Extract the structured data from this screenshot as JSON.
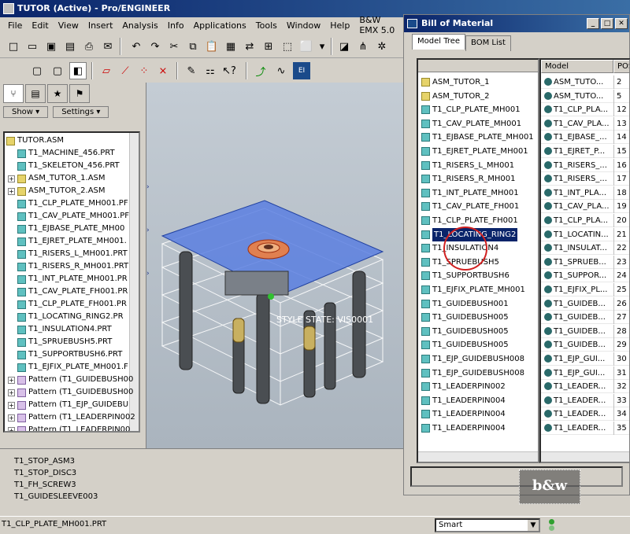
{
  "app": {
    "title": "TUTOR (Active) - Pro/ENGINEER"
  },
  "menu": [
    "File",
    "Edit",
    "View",
    "Insert",
    "Analysis",
    "Info",
    "Applications",
    "Tools",
    "Window",
    "Help",
    "B&W EMX 5.0"
  ],
  "left_panel": {
    "show_label": "Show",
    "settings_label": "Settings",
    "tree": [
      {
        "label": "TUTOR.ASM",
        "type": "asm",
        "expander": false,
        "indent": 0
      },
      {
        "label": "T1_MACHINE_456.PRT",
        "type": "prt",
        "expander": false,
        "indent": 1
      },
      {
        "label": "T1_SKELETON_456.PRT",
        "type": "prt",
        "expander": false,
        "indent": 1
      },
      {
        "label": "ASM_TUTOR_1.ASM",
        "type": "asm",
        "expander": true,
        "indent": 1
      },
      {
        "label": "ASM_TUTOR_2.ASM",
        "type": "asm",
        "expander": true,
        "indent": 1
      },
      {
        "label": "T1_CLP_PLATE_MH001.PF",
        "type": "prt",
        "expander": false,
        "indent": 1
      },
      {
        "label": "T1_CAV_PLATE_MH001.PF",
        "type": "prt",
        "expander": false,
        "indent": 1
      },
      {
        "label": "T1_EJBASE_PLATE_MH00",
        "type": "prt",
        "expander": false,
        "indent": 1
      },
      {
        "label": "T1_EJRET_PLATE_MH001.",
        "type": "prt",
        "expander": false,
        "indent": 1
      },
      {
        "label": "T1_RISERS_L_MH001.PRT",
        "type": "prt",
        "expander": false,
        "indent": 1
      },
      {
        "label": "T1_RISERS_R_MH001.PRT",
        "type": "prt",
        "expander": false,
        "indent": 1
      },
      {
        "label": "T1_INT_PLATE_MH001.PR",
        "type": "prt",
        "expander": false,
        "indent": 1
      },
      {
        "label": "T1_CAV_PLATE_FH001.PR",
        "type": "prt",
        "expander": false,
        "indent": 1
      },
      {
        "label": "T1_CLP_PLATE_FH001.PR",
        "type": "prt",
        "expander": false,
        "indent": 1
      },
      {
        "label": "T1_LOCATING_RING2.PR",
        "type": "prt",
        "expander": false,
        "indent": 1
      },
      {
        "label": "T1_INSULATION4.PRT",
        "type": "prt",
        "expander": false,
        "indent": 1
      },
      {
        "label": "T1_SPRUEBUSH5.PRT",
        "type": "prt",
        "expander": false,
        "indent": 1
      },
      {
        "label": "T1_SUPPORTBUSH6.PRT",
        "type": "prt",
        "expander": false,
        "indent": 1
      },
      {
        "label": "T1_EJFIX_PLATE_MH001.F",
        "type": "prt",
        "expander": false,
        "indent": 1
      },
      {
        "label": "Pattern (T1_GUIDEBUSH00",
        "type": "pat",
        "expander": true,
        "indent": 1
      },
      {
        "label": "Pattern (T1_GUIDEBUSH00",
        "type": "pat",
        "expander": true,
        "indent": 1
      },
      {
        "label": "Pattern (T1_EJP_GUIDEBU",
        "type": "pat",
        "expander": true,
        "indent": 1
      },
      {
        "label": "Pattern (T1_LEADERPIN002",
        "type": "pat",
        "expander": true,
        "indent": 1
      },
      {
        "label": "Pattern (T1_LEADERPIN00",
        "type": "pat",
        "expander": true,
        "indent": 1
      }
    ]
  },
  "viewport": {
    "overlay_text": "STYLE STATE: VIS0001"
  },
  "messages": [
    "T1_STOP_ASM3",
    "T1_STOP_DISC3",
    "T1_FH_SCREW3",
    "T1_GUIDESLEEVE003"
  ],
  "status": {
    "current": "T1_CLP_PLATE_MH001.PRT",
    "filter": "Smart"
  },
  "bom": {
    "title": "Bill of Material",
    "tabs": [
      "Model Tree",
      "BOM List"
    ],
    "col_model": "Model",
    "col_pos": "POS",
    "tree": [
      {
        "label": "ASM_TUTOR_1",
        "type": "asm"
      },
      {
        "label": "ASM_TUTOR_2",
        "type": "asm"
      },
      {
        "label": "T1_CLP_PLATE_MH001",
        "type": "prt"
      },
      {
        "label": "T1_CAV_PLATE_MH001",
        "type": "prt"
      },
      {
        "label": "T1_EJBASE_PLATE_MH001",
        "type": "prt"
      },
      {
        "label": "T1_EJRET_PLATE_MH001",
        "type": "prt"
      },
      {
        "label": "T1_RISERS_L_MH001",
        "type": "prt"
      },
      {
        "label": "T1_RISERS_R_MH001",
        "type": "prt"
      },
      {
        "label": "T1_INT_PLATE_MH001",
        "type": "prt"
      },
      {
        "label": "T1_CAV_PLATE_FH001",
        "type": "prt"
      },
      {
        "label": "T1_CLP_PLATE_FH001",
        "type": "prt"
      },
      {
        "label": "T1_LOCATING_RING2",
        "type": "prt",
        "selected": true
      },
      {
        "label": "T1_INSULATION4",
        "type": "prt"
      },
      {
        "label": "T1_SPRUEBUSH5",
        "type": "prt"
      },
      {
        "label": "T1_SUPPORTBUSH6",
        "type": "prt"
      },
      {
        "label": "T1_EJFIX_PLATE_MH001",
        "type": "prt"
      },
      {
        "label": "T1_GUIDEBUSH001",
        "type": "prt"
      },
      {
        "label": "T1_GUIDEBUSH005",
        "type": "prt"
      },
      {
        "label": "T1_GUIDEBUSH005",
        "type": "prt"
      },
      {
        "label": "T1_GUIDEBUSH005",
        "type": "prt"
      },
      {
        "label": "T1_EJP_GUIDEBUSH008",
        "type": "prt"
      },
      {
        "label": "T1_EJP_GUIDEBUSH008",
        "type": "prt"
      },
      {
        "label": "T1_LEADERPIN002",
        "type": "prt"
      },
      {
        "label": "T1_LEADERPIN004",
        "type": "prt"
      },
      {
        "label": "T1_LEADERPIN004",
        "type": "prt"
      },
      {
        "label": "T1_LEADERPIN004",
        "type": "prt"
      }
    ],
    "rows": [
      {
        "model": "ASM_TUTO...",
        "pos": "2"
      },
      {
        "model": "ASM_TUTO...",
        "pos": "5"
      },
      {
        "model": "T1_CLP_PLA...",
        "pos": "12"
      },
      {
        "model": "T1_CAV_PLA...",
        "pos": "13"
      },
      {
        "model": "T1_EJBASE_...",
        "pos": "14"
      },
      {
        "model": "T1_EJRET_P...",
        "pos": "15"
      },
      {
        "model": "T1_RISERS_...",
        "pos": "16"
      },
      {
        "model": "T1_RISERS_...",
        "pos": "17"
      },
      {
        "model": "T1_INT_PLA...",
        "pos": "18"
      },
      {
        "model": "T1_CAV_PLA...",
        "pos": "19"
      },
      {
        "model": "T1_CLP_PLA...",
        "pos": "20"
      },
      {
        "model": "T1_LOCATIN...",
        "pos": "21"
      },
      {
        "model": "T1_INSULAT...",
        "pos": "22"
      },
      {
        "model": "T1_SPRUEB...",
        "pos": "23"
      },
      {
        "model": "T1_SUPPOR...",
        "pos": "24"
      },
      {
        "model": "T1_EJFIX_PL...",
        "pos": "25"
      },
      {
        "model": "T1_GUIDEB...",
        "pos": "26"
      },
      {
        "model": "T1_GUIDEB...",
        "pos": "27"
      },
      {
        "model": "T1_GUIDEB...",
        "pos": "28"
      },
      {
        "model": "T1_GUIDEB...",
        "pos": "29"
      },
      {
        "model": "T1_EJP_GUI...",
        "pos": "30"
      },
      {
        "model": "T1_EJP_GUI...",
        "pos": "31"
      },
      {
        "model": "T1_LEADER...",
        "pos": "32"
      },
      {
        "model": "T1_LEADER...",
        "pos": "33"
      },
      {
        "model": "T1_LEADER...",
        "pos": "34"
      },
      {
        "model": "T1_LEADER...",
        "pos": "35"
      }
    ]
  },
  "watermark": {
    "text": "b&w software"
  },
  "colors": {
    "title_bar": "#0a246a",
    "selection": "#0a246a",
    "part_icon": "#5fc0c0",
    "plate_blue": "#5b7fe0",
    "ring": "#e07840"
  }
}
